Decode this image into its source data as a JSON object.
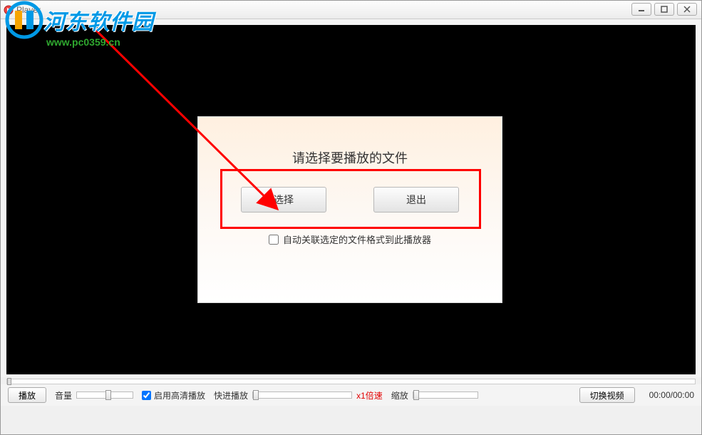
{
  "window": {
    "title": "Player"
  },
  "watermark": {
    "name": "河东软件园",
    "url": "www.pc0359.cn"
  },
  "dialog": {
    "title": "请选择要播放的文件",
    "select_label": "选择",
    "exit_label": "退出",
    "assoc_label": "自动关联选定的文件格式到此播放器",
    "assoc_checked": false
  },
  "bottombar": {
    "play_label": "播放",
    "volume_label": "音量",
    "hd_label": "启用高清播放",
    "hd_checked": true,
    "fast_label": "快进播放",
    "speed_text": "x1倍速",
    "zoom_label": "缩放",
    "switch_label": "切换视频",
    "time_readout": "00:00/00:00"
  }
}
